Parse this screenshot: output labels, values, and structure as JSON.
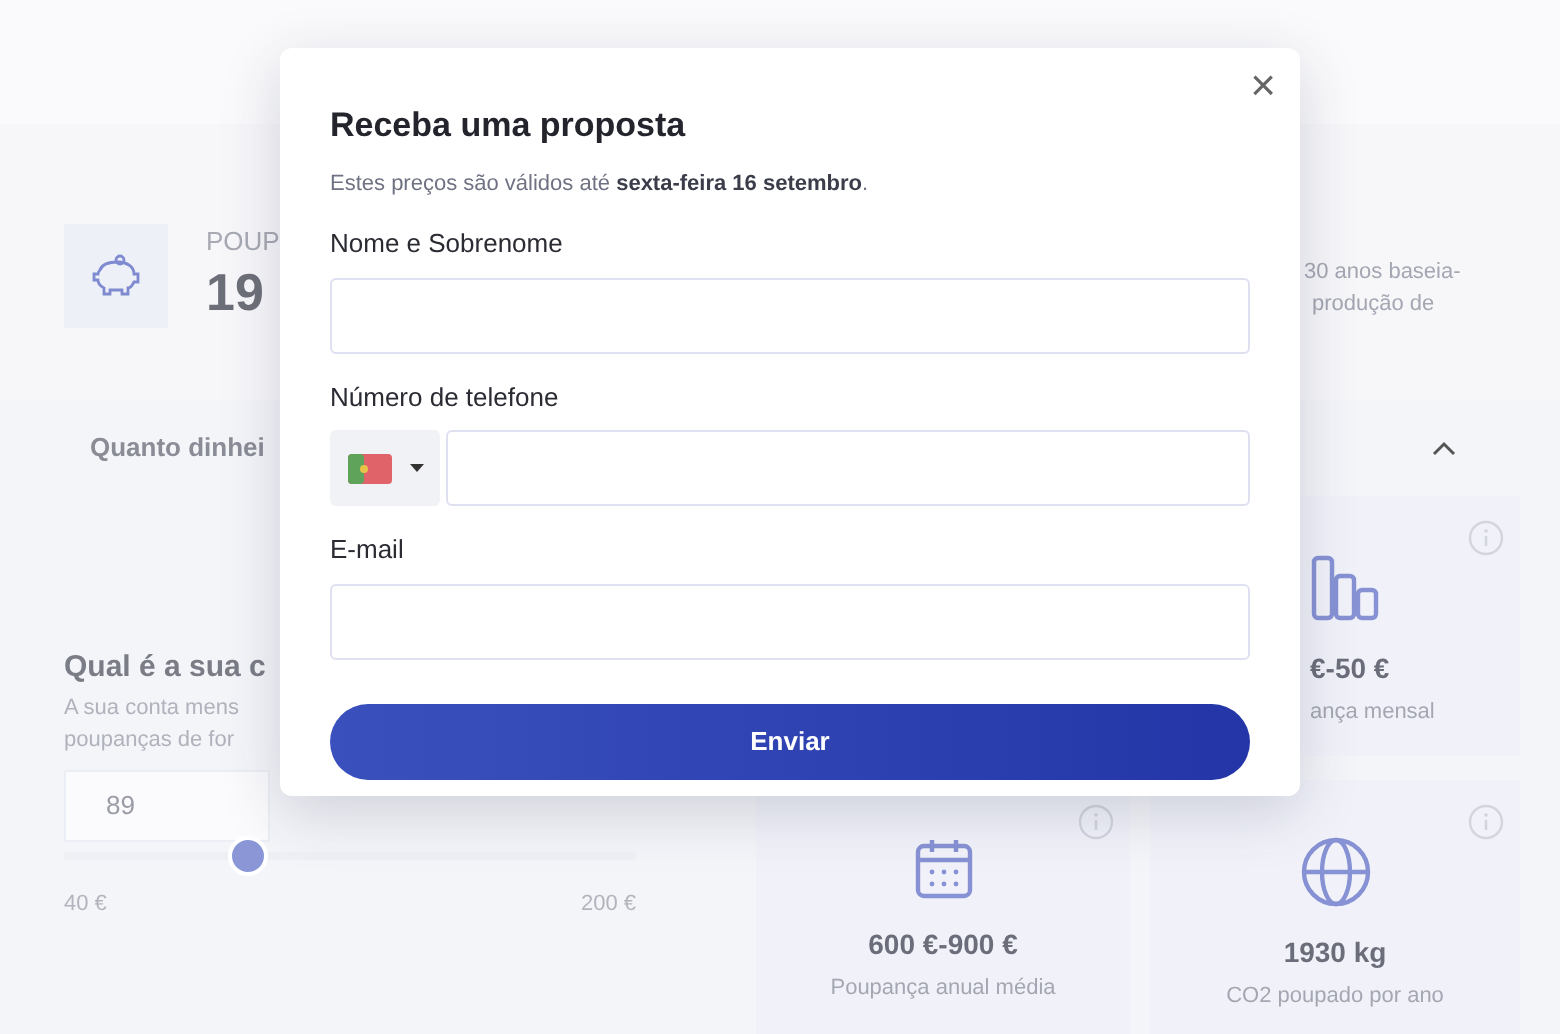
{
  "background": {
    "savings": {
      "label": "POUP",
      "value": "19"
    },
    "description": [
      "30 anos baseia-",
      "produção de"
    ],
    "question": {
      "text": "Quanto dinhei",
      "expanded": true
    },
    "bill": {
      "title": "Qual é a sua c",
      "hint": [
        "A sua conta mens",
        "poupanças de for"
      ],
      "value": "89",
      "level": 0.32,
      "min": "40 €",
      "max": "200 €"
    },
    "stats": [
      {
        "kind": "chart",
        "value": "€-50 €",
        "label": "ança mensal"
      },
      {
        "kind": "calendar",
        "value": "600 €-900 €",
        "label": "Poupança anual média"
      },
      {
        "kind": "globe",
        "value": "1930 kg",
        "label": "CO2 poupado por ano"
      }
    ]
  },
  "modal": {
    "title": "Receba uma proposta",
    "subtitle": "Estes preços são válidos até **sexta-feira 16 setembro**.",
    "close": "×",
    "fields": [
      {
        "kind": "text",
        "label": "Nome e Sobrenome"
      },
      {
        "kind": "phone",
        "label": "Número de telefone"
      },
      {
        "kind": "text",
        "label": "E-mail"
      }
    ],
    "submit": "Enviar"
  }
}
